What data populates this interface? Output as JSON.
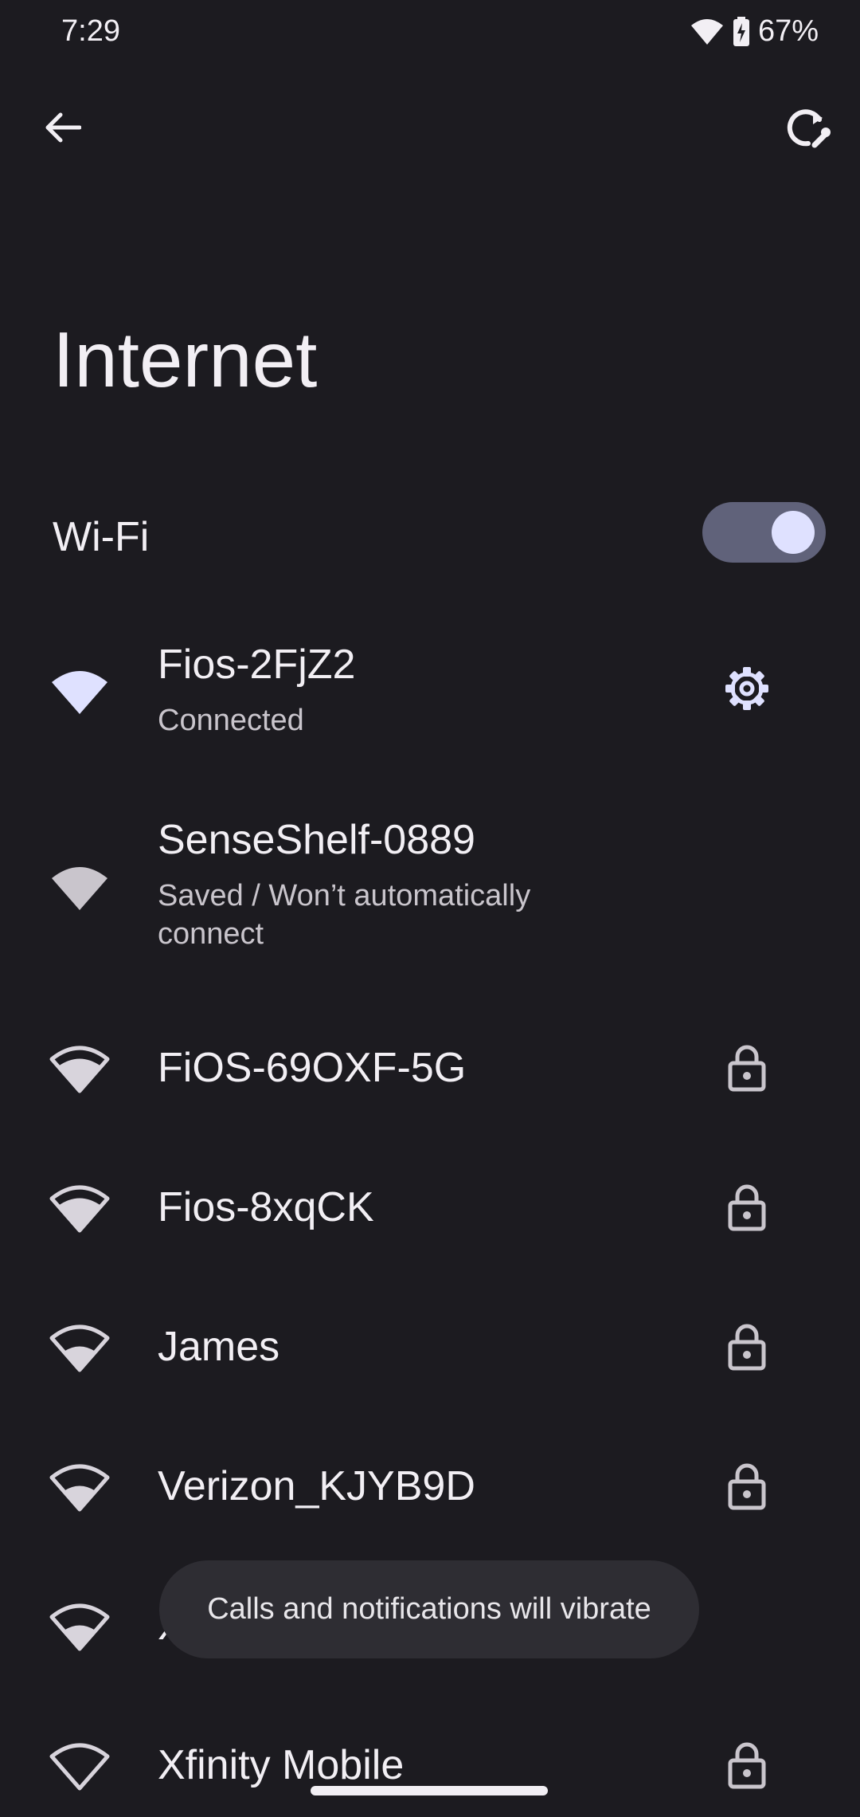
{
  "status_bar": {
    "time": "7:29",
    "battery_percent": "67%"
  },
  "header": {
    "back_icon": "arrow-back-icon",
    "refresh_icon": "network-refresh-icon"
  },
  "page": {
    "title": "Internet"
  },
  "wifi": {
    "label": "Wi-Fi",
    "enabled": true,
    "accent": "#dfe1ff"
  },
  "networks": [
    {
      "name": "Fios-2FjZ2",
      "status": "Connected",
      "action_icon": "gear-icon"
    },
    {
      "name": "SenseShelf-0889",
      "status": "Saved / Won’t automatically connect",
      "action_icon": ""
    },
    {
      "name": "FiOS-69OXF-5G",
      "status": "",
      "action_icon": "lock-icon"
    },
    {
      "name": "Fios-8xqCK",
      "status": "",
      "action_icon": "lock-icon"
    },
    {
      "name": "James",
      "status": "",
      "action_icon": "lock-icon"
    },
    {
      "name": "Verizon_KJYB9D",
      "status": "",
      "action_icon": "lock-icon"
    },
    {
      "name": "X",
      "status": "",
      "action_icon": ""
    },
    {
      "name": "Xfinity Mobile",
      "status": "",
      "action_icon": "lock-icon"
    }
  ],
  "toast": {
    "text": "Calls and notifications will vibrate"
  }
}
